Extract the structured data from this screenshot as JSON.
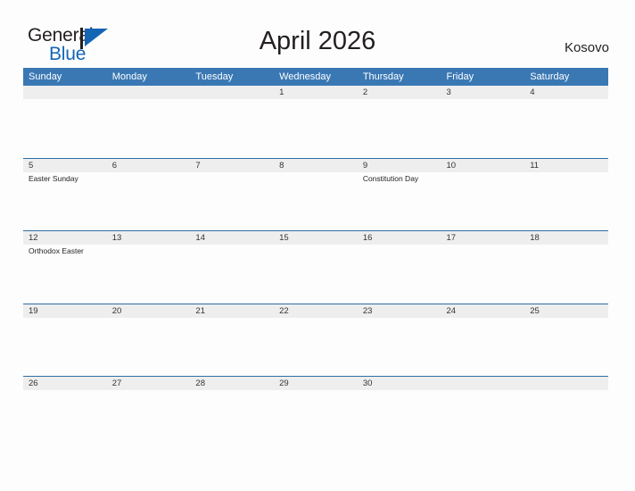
{
  "brand": {
    "name_part1": "General",
    "name_part2": "Blue",
    "flag_icon": "flag-triangle-icon",
    "accent_color": "#1565b5"
  },
  "header": {
    "title": "April 2026",
    "country": "Kosovo"
  },
  "theme": {
    "header_blue": "#3a78b4",
    "row_border_blue": "#2e6da4",
    "date_band_gray": "#eeeeee",
    "page_background": "#fdfdfd",
    "text_dark": "#231f20"
  },
  "calendar": {
    "month": "April",
    "year": "2026",
    "weekday_headers": [
      "Sunday",
      "Monday",
      "Tuesday",
      "Wednesday",
      "Thursday",
      "Friday",
      "Saturday"
    ],
    "weeks": [
      {
        "days": [
          {
            "date": "",
            "events": []
          },
          {
            "date": "",
            "events": []
          },
          {
            "date": "",
            "events": []
          },
          {
            "date": "1",
            "events": []
          },
          {
            "date": "2",
            "events": []
          },
          {
            "date": "3",
            "events": []
          },
          {
            "date": "4",
            "events": []
          }
        ]
      },
      {
        "days": [
          {
            "date": "5",
            "events": [
              "Easter Sunday"
            ]
          },
          {
            "date": "6",
            "events": []
          },
          {
            "date": "7",
            "events": []
          },
          {
            "date": "8",
            "events": []
          },
          {
            "date": "9",
            "events": [
              "Constitution Day"
            ]
          },
          {
            "date": "10",
            "events": []
          },
          {
            "date": "11",
            "events": []
          }
        ]
      },
      {
        "days": [
          {
            "date": "12",
            "events": [
              "Orthodox Easter"
            ]
          },
          {
            "date": "13",
            "events": []
          },
          {
            "date": "14",
            "events": []
          },
          {
            "date": "15",
            "events": []
          },
          {
            "date": "16",
            "events": []
          },
          {
            "date": "17",
            "events": []
          },
          {
            "date": "18",
            "events": []
          }
        ]
      },
      {
        "days": [
          {
            "date": "19",
            "events": []
          },
          {
            "date": "20",
            "events": []
          },
          {
            "date": "21",
            "events": []
          },
          {
            "date": "22",
            "events": []
          },
          {
            "date": "23",
            "events": []
          },
          {
            "date": "24",
            "events": []
          },
          {
            "date": "25",
            "events": []
          }
        ]
      },
      {
        "days": [
          {
            "date": "26",
            "events": []
          },
          {
            "date": "27",
            "events": []
          },
          {
            "date": "28",
            "events": []
          },
          {
            "date": "29",
            "events": []
          },
          {
            "date": "30",
            "events": []
          },
          {
            "date": "",
            "events": []
          },
          {
            "date": "",
            "events": []
          }
        ]
      }
    ]
  }
}
